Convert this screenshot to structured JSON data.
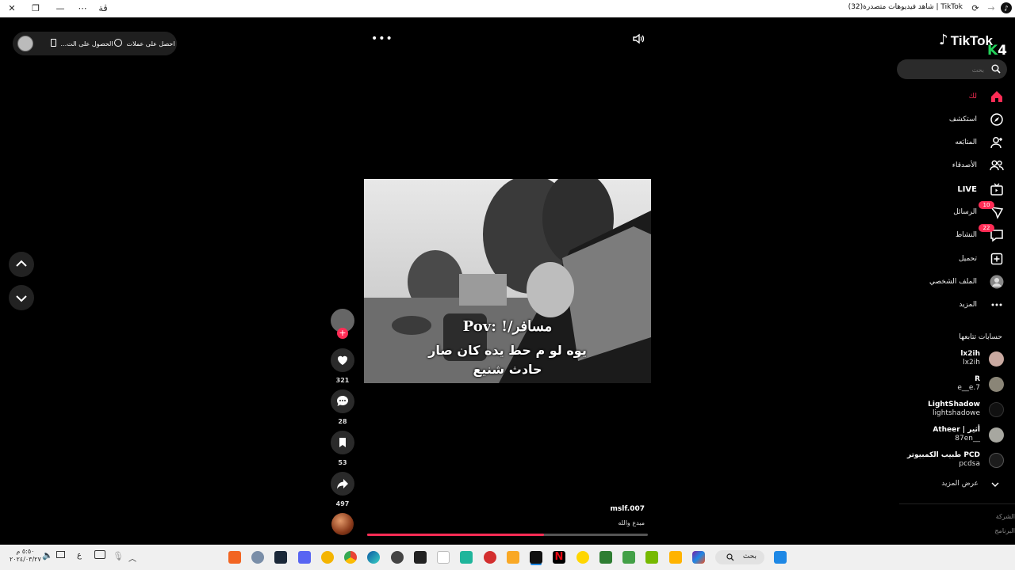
{
  "window": {
    "title": "TikTok | شاهد فيديوهات متصدرة(32)",
    "extension_label": "ڤة"
  },
  "topbar": {
    "get_coins": "احصل على عملات",
    "get_app": "الحصول على الت..."
  },
  "sidebar": {
    "logo": "TikTok",
    "logo_k": "K",
    "logo_4": "4",
    "search_placeholder": "بحث",
    "nav": [
      {
        "label": "لك",
        "icon": "home-icon",
        "active": true
      },
      {
        "label": "استكشف",
        "icon": "compass-icon"
      },
      {
        "label": "المتابَعه",
        "icon": "user-plus-icon"
      },
      {
        "label": "الأصدقاء",
        "icon": "friends-icon"
      },
      {
        "label": "LIVE",
        "icon": "live-tv-icon"
      },
      {
        "label": "الرسائل",
        "icon": "messages-icon",
        "badge": "10"
      },
      {
        "label": "النشاط",
        "icon": "activity-icon",
        "badge": "22"
      },
      {
        "label": "تحميل",
        "icon": "upload-icon"
      },
      {
        "label": "الملف الشخصي",
        "icon": "profile-avatar"
      },
      {
        "label": "المزيد",
        "icon": "more-icon"
      }
    ],
    "following_title": "حسابات تتابعها",
    "following": [
      {
        "name": "lx2ih",
        "handle": "lx2ih"
      },
      {
        "name": "R",
        "handle": "e__e.7"
      },
      {
        "name": "LightShadow",
        "handle": "lightshadowe"
      },
      {
        "name": "Atheer | أثير",
        "handle": "87en__"
      },
      {
        "name": "طبيب الكمبيوتر PCD",
        "handle": "pcdsa"
      }
    ],
    "see_more": "عرض المزيد",
    "footer": [
      "الشركة",
      "البرنامج"
    ]
  },
  "video": {
    "overlay_line1": "مسافر/! :Pov",
    "overlay_line2": "يوه لو م حط يده كان صار",
    "overlay_line3": "حادث شنيع",
    "author": "mslf.007",
    "caption": "مبدع والله",
    "progress": 0.63
  },
  "actions": {
    "likes": "321",
    "comments": "28",
    "saves": "53",
    "shares": "497"
  },
  "taskbar": {
    "search": "بحث",
    "lang": "ع",
    "time": "٥:٥٠ م",
    "date": "٢٠٢٤/٠٣/٢٧"
  },
  "colors": {
    "accent": "#fe2c55",
    "background": "#000000",
    "logo_green": "#23d15a"
  }
}
